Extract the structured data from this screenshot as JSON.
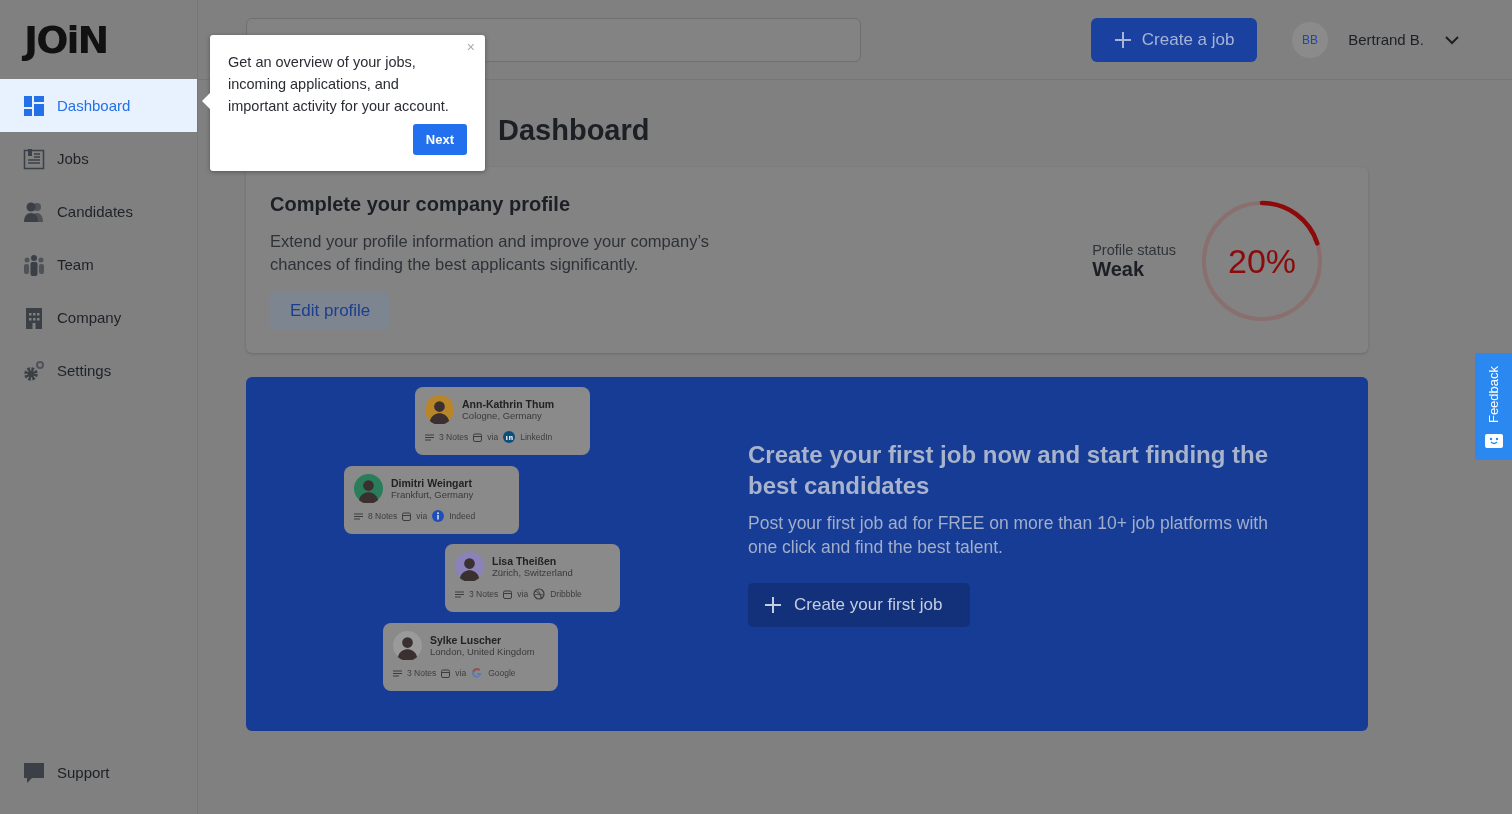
{
  "logo": "JOiN",
  "sidebar": {
    "items": [
      {
        "label": "Dashboard",
        "kind": "dashboard",
        "selected": true
      },
      {
        "label": "Jobs",
        "kind": "jobs",
        "selected": false
      },
      {
        "label": "Candidates",
        "kind": "candidates",
        "selected": false
      },
      {
        "label": "Team",
        "kind": "team",
        "selected": false
      },
      {
        "label": "Company",
        "kind": "company",
        "selected": false
      },
      {
        "label": "Settings",
        "kind": "settings",
        "selected": false
      }
    ],
    "support": "Support"
  },
  "header": {
    "create_button": "Create a job",
    "user": {
      "initials": "BB",
      "name": "Bertrand B."
    }
  },
  "page_title": "Dashboard",
  "profile_card": {
    "title": "Complete your company profile",
    "text": "Extend your profile information and improve your company’s chances of finding the best applicants significantly.",
    "button": "Edit profile",
    "status_label": "Profile status",
    "status": "Weak",
    "level": 0.2,
    "percent": "20%"
  },
  "banner": {
    "title": "Create your first job now and start finding the best candidates",
    "text": "Post your first job ad for FREE on more than 10+ job platforms with one click and find the best talent.",
    "button": "Create your first job",
    "candidates": [
      {
        "name": "Ann-Kathrin Thum",
        "location": "Cologne, Germany",
        "notes": "3 Notes",
        "via": "via",
        "source": "LinkedIn",
        "kind": "linkedin"
      },
      {
        "name": "Dimitri Weingart",
        "location": "Frankfurt, Germany",
        "notes": "8 Notes",
        "via": "via",
        "source": "Indeed",
        "kind": "indeed"
      },
      {
        "name": "Lisa Theißen",
        "location": "Zürich, Switzerland",
        "notes": "3 Notes",
        "via": "via",
        "source": "Dribbble",
        "kind": "dribbble"
      },
      {
        "name": "Sylke Luscher",
        "location": "London, United Kingdom",
        "notes": "3 Notes",
        "via": "via",
        "source": "Google",
        "kind": "google"
      }
    ]
  },
  "tooltip": {
    "text": "Get an overview of your jobs, incoming applications, and important activity for your account.",
    "close": "×",
    "button": "Next"
  },
  "feedback": "Feedback"
}
